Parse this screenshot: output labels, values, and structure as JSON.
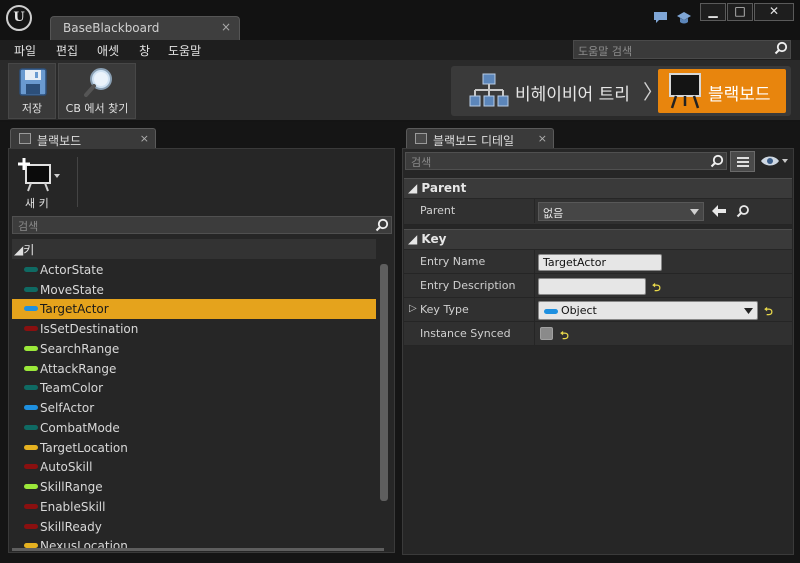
{
  "window": {
    "tab_title": "BaseBlackboard",
    "tab_close": "×",
    "min": "▁",
    "max": "□",
    "close": "✕"
  },
  "menu": {
    "items": [
      "파일",
      "편집",
      "애셋",
      "창",
      "도움말"
    ]
  },
  "help_search": {
    "placeholder": "도움말 검색"
  },
  "toolbar": {
    "save": "저장",
    "find_in_cb": "CB 에서 찾기"
  },
  "modes": {
    "behavior_tree": "비헤이비어 트리",
    "blackboard": "블랙보드",
    "chevron": "〉"
  },
  "left_panel": {
    "tab": "블랙보드",
    "new_key": "새 키",
    "search_placeholder": "검색",
    "category": "◢키",
    "keys": [
      {
        "label": "ActorState",
        "color": "#0f6a63"
      },
      {
        "label": "MoveState",
        "color": "#0f6a63"
      },
      {
        "label": "TargetActor",
        "color": "#1e90e0",
        "selected": true
      },
      {
        "label": "IsSetDestination",
        "color": "#8a1010"
      },
      {
        "label": "SearchRange",
        "color": "#9be83a"
      },
      {
        "label": "AttackRange",
        "color": "#9be83a"
      },
      {
        "label": "TeamColor",
        "color": "#0f6a63"
      },
      {
        "label": "SelfActor",
        "color": "#1e90e0"
      },
      {
        "label": "CombatMode",
        "color": "#0f6a63"
      },
      {
        "label": "TargetLocation",
        "color": "#e5b120"
      },
      {
        "label": "AutoSkill",
        "color": "#8a1010"
      },
      {
        "label": "SkillRange",
        "color": "#9be83a"
      },
      {
        "label": "EnableSkill",
        "color": "#8a1010"
      },
      {
        "label": "SkillReady",
        "color": "#8a1010"
      },
      {
        "label": "NexusLocation",
        "color": "#e5b120"
      }
    ]
  },
  "right_panel": {
    "tab": "블랙보드 디테일",
    "search_placeholder": "검색",
    "parent_category": "◢ Parent",
    "parent_label": "Parent",
    "parent_value": "없음",
    "key_category": "◢ Key",
    "entry_name_label": "Entry Name",
    "entry_name_value": "TargetActor",
    "entry_desc_label": "Entry Description",
    "entry_desc_value": "",
    "key_type_label": "Key Type",
    "key_type_value": "Object",
    "key_type_expander": "▷",
    "instance_synced_label": "Instance Synced"
  },
  "colors": {
    "accent": "#e8850d",
    "selection": "#e5a31c",
    "reset_arrow": "#e8d84a"
  }
}
